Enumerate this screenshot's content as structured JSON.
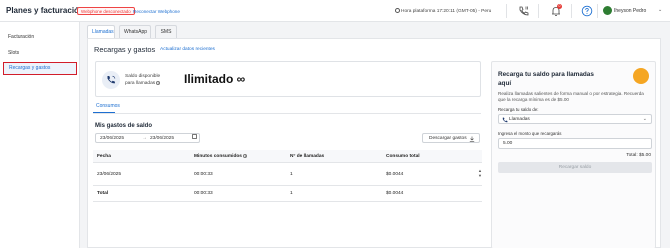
{
  "header": {
    "title": "Planes y facturación",
    "status_badge": "Webphone desconectado",
    "reconnect_link": "Reconectar Webphone",
    "clock": "Hora plataforma 17:20:11 (GMT-05) - Peru",
    "notifications_count": "0",
    "user_name": "Iheyson Pedro"
  },
  "sidebar": {
    "items": [
      {
        "label": "Facturación"
      },
      {
        "label": "Slots"
      },
      {
        "label": "Recargas y gastos"
      }
    ]
  },
  "tabs": [
    {
      "label": "Llamadas"
    },
    {
      "label": "WhatsApp"
    },
    {
      "label": "SMS"
    }
  ],
  "main": {
    "title": "Recargas y gastos",
    "refresh_link": "Actualizar datos recientes",
    "balance": {
      "label_line1": "Saldo disponible",
      "label_line2": "para llamadas",
      "value": "Ilimitado ∞"
    },
    "subtab": "Consumos",
    "section_title": "Mis gastos de saldo",
    "date_from": "23/06/2025",
    "date_to": "23/06/2025",
    "date_arrow": "→",
    "download_label": "Descargar gastos",
    "table": {
      "headers": [
        "Fecha",
        "Minutos consumidos",
        "N° de llamadas",
        "Consumo total"
      ],
      "rows": [
        [
          "23/06/2025",
          "00:00:33",
          "1",
          "$0.0044"
        ]
      ],
      "total": [
        "Total",
        "00:00:33",
        "1",
        "$0.0044"
      ]
    }
  },
  "recharge": {
    "title": "Recarga tu saldo para llamadas aquí",
    "description": "Realiza llamadas salientes de forma manual o por estrategia. Recuerda que la recarga mínima es de $5.00",
    "select_label": "Recarga tu saldo de:",
    "select_value": "Llamadas",
    "amount_label": "Ingresa el monto que recargarás",
    "amount_value": "5.00",
    "total": "Total: $5.00",
    "button": "Recargar saldo"
  }
}
